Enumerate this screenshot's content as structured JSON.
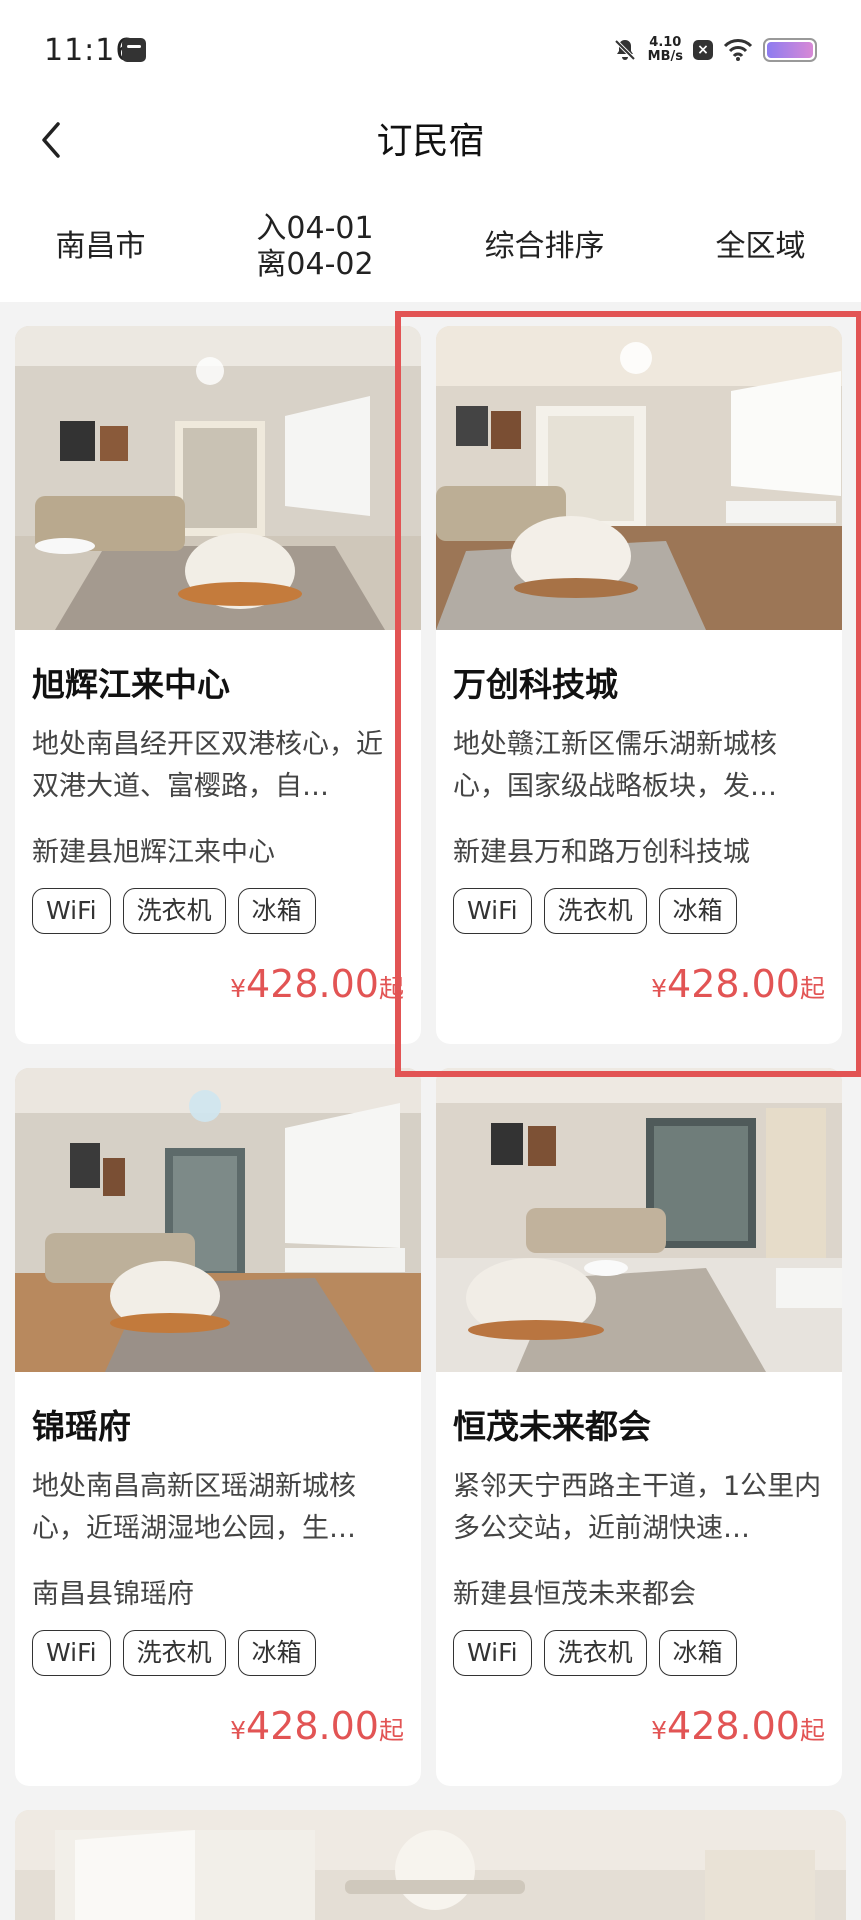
{
  "status": {
    "time": "11:16",
    "net_speed_value": "4.10",
    "net_speed_unit": "MB/s"
  },
  "header": {
    "title": "订民宿"
  },
  "filters": {
    "city": "南昌市",
    "checkin": "入04-01",
    "checkout": "离04-02",
    "sort": "综合排序",
    "region": "全区域"
  },
  "listings": [
    {
      "title": "旭辉江来中心",
      "description": "地处南昌经开区双港核心，近双港大道、富樱路，自…",
      "address": "新建县旭辉江来中心",
      "tags": [
        "WiFi",
        "洗衣机",
        "冰箱"
      ],
      "price_symbol": "¥",
      "price": "428.00",
      "price_suffix": "起"
    },
    {
      "title": "万创科技城",
      "description": "地处赣江新区儒乐湖新城核心，国家级战略板块，发…",
      "address": "新建县万和路万创科技城",
      "tags": [
        "WiFi",
        "洗衣机",
        "冰箱"
      ],
      "price_symbol": "¥",
      "price": "428.00",
      "price_suffix": "起"
    },
    {
      "title": "锦瑶府",
      "description": "地处南昌高新区瑶湖新城核心，近瑶湖湿地公园，生…",
      "address": "南昌县锦瑶府",
      "tags": [
        "WiFi",
        "洗衣机",
        "冰箱"
      ],
      "price_symbol": "¥",
      "price": "428.00",
      "price_suffix": "起"
    },
    {
      "title": "恒茂未来都会",
      "description": "紧邻天宁西路主干道，1公里内多公交站，近前湖快速…",
      "address": "新建县恒茂未来都会",
      "tags": [
        "WiFi",
        "洗衣机",
        "冰箱"
      ],
      "price_symbol": "¥",
      "price": "428.00",
      "price_suffix": "起"
    }
  ],
  "colors": {
    "accent": "#e25454",
    "background": "#f3f3f3",
    "card": "#ffffff"
  },
  "icons": {
    "back": "chevron-left-icon"
  }
}
